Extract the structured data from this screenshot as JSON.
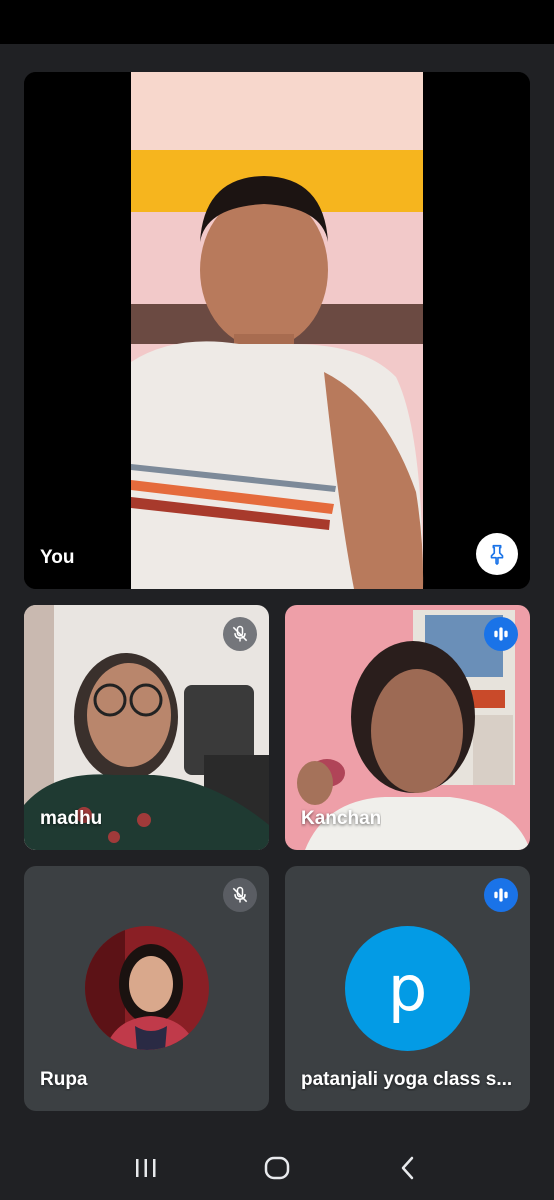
{
  "participants": {
    "self": {
      "name": "You"
    },
    "madhu": {
      "name": "madhu"
    },
    "kanchan": {
      "name": "Kanchan"
    },
    "rupa": {
      "name": "Rupa"
    },
    "patanjali": {
      "name": "patanjali yoga class s...",
      "avatar_letter": "p"
    }
  },
  "colors": {
    "background": "#202124",
    "tile": "#3c4043",
    "speaking_badge": "#1a73e8",
    "avatar_blue": "#039be5"
  },
  "icons": {
    "pin": "pin-icon",
    "mic_off": "mic-off-icon",
    "speaking": "audio-level-icon",
    "nav_recents": "recents-icon",
    "nav_home": "home-icon",
    "nav_back": "back-icon"
  }
}
